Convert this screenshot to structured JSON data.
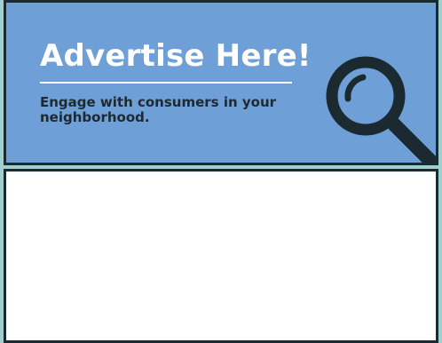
{
  "ad": {
    "title": "Advertise Here!",
    "tagline": "Engage with consumers in your neighborhood.",
    "icon": "magnifying-glass-icon",
    "colors": {
      "banner_background": "#6e9fd6",
      "page_background": "#9fcfce",
      "title_text": "#ffffff",
      "tagline_text": "#1f2a30",
      "border": "#1b2a30"
    }
  },
  "content_panel": {
    "background": "#ffffff"
  }
}
